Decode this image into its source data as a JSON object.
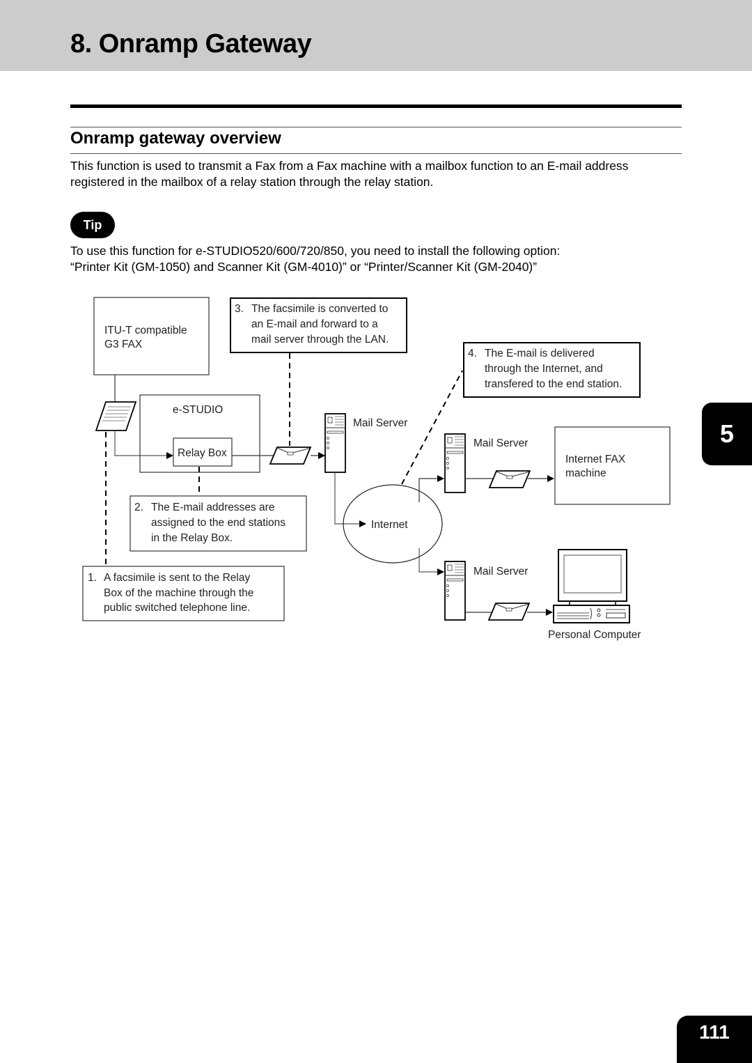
{
  "header": {
    "chapter_title": "8. Onramp Gateway"
  },
  "section": {
    "title": "Onramp gateway overview"
  },
  "intro": {
    "line1": "This function is used to transmit a Fax from a Fax machine with a mailbox function to an E-mail address",
    "line2": "registered in the mailbox of a relay station through the relay station."
  },
  "tip": {
    "label": "Tip",
    "line1": "To use this function for e-STUDIO520/600/720/850, you need to install the following option:",
    "line2": "“Printer Kit (GM-1050) and Scanner Kit (GM-4010)” or “Printer/Scanner Kit (GM-2040)”"
  },
  "diagram": {
    "g3fax": [
      "ITU-T compatible",
      "G3 FAX"
    ],
    "estudio": "e-STUDIO",
    "relay_box": "Relay Box",
    "mail_server_1": "Mail Server",
    "mail_server_2": "Mail Server",
    "mail_server_3": "Mail Server",
    "internet": "Internet",
    "internet_fax": [
      "Internet FAX",
      "machine"
    ],
    "personal_computer": "Personal Computer",
    "steps": [
      {
        "num": "1.",
        "lines": [
          "A facsimile is sent to the Relay",
          "Box of the machine through the",
          "public switched telephone line."
        ]
      },
      {
        "num": "2.",
        "lines": [
          "The E-mail addresses are",
          "assigned to the end stations",
          "in the Relay Box."
        ]
      },
      {
        "num": "3.",
        "lines": [
          "The facsimile is converted to",
          "an E-mail and forward to a",
          "mail server through the LAN."
        ]
      },
      {
        "num": "4.",
        "lines": [
          "The E-mail is delivered",
          "through the Internet, and",
          "transfered to the end station."
        ]
      }
    ]
  },
  "side_tab": {
    "chapter_number": "5"
  },
  "footer": {
    "page_number": "111"
  }
}
